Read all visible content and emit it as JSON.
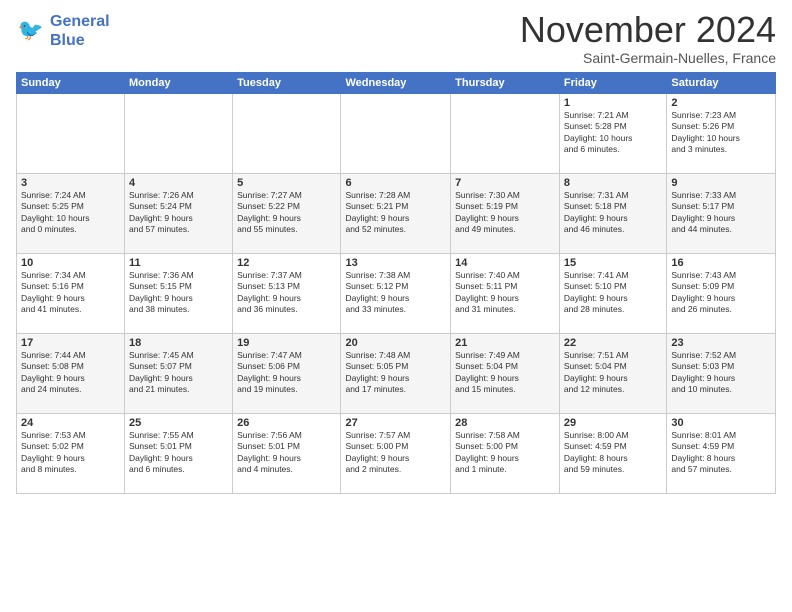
{
  "logo": {
    "line1": "General",
    "line2": "Blue"
  },
  "title": "November 2024",
  "subtitle": "Saint-Germain-Nuelles, France",
  "weekdays": [
    "Sunday",
    "Monday",
    "Tuesday",
    "Wednesday",
    "Thursday",
    "Friday",
    "Saturday"
  ],
  "weeks": [
    [
      {
        "day": "",
        "info": ""
      },
      {
        "day": "",
        "info": ""
      },
      {
        "day": "",
        "info": ""
      },
      {
        "day": "",
        "info": ""
      },
      {
        "day": "",
        "info": ""
      },
      {
        "day": "1",
        "info": "Sunrise: 7:21 AM\nSunset: 5:28 PM\nDaylight: 10 hours\nand 6 minutes."
      },
      {
        "day": "2",
        "info": "Sunrise: 7:23 AM\nSunset: 5:26 PM\nDaylight: 10 hours\nand 3 minutes."
      }
    ],
    [
      {
        "day": "3",
        "info": "Sunrise: 7:24 AM\nSunset: 5:25 PM\nDaylight: 10 hours\nand 0 minutes."
      },
      {
        "day": "4",
        "info": "Sunrise: 7:26 AM\nSunset: 5:24 PM\nDaylight: 9 hours\nand 57 minutes."
      },
      {
        "day": "5",
        "info": "Sunrise: 7:27 AM\nSunset: 5:22 PM\nDaylight: 9 hours\nand 55 minutes."
      },
      {
        "day": "6",
        "info": "Sunrise: 7:28 AM\nSunset: 5:21 PM\nDaylight: 9 hours\nand 52 minutes."
      },
      {
        "day": "7",
        "info": "Sunrise: 7:30 AM\nSunset: 5:19 PM\nDaylight: 9 hours\nand 49 minutes."
      },
      {
        "day": "8",
        "info": "Sunrise: 7:31 AM\nSunset: 5:18 PM\nDaylight: 9 hours\nand 46 minutes."
      },
      {
        "day": "9",
        "info": "Sunrise: 7:33 AM\nSunset: 5:17 PM\nDaylight: 9 hours\nand 44 minutes."
      }
    ],
    [
      {
        "day": "10",
        "info": "Sunrise: 7:34 AM\nSunset: 5:16 PM\nDaylight: 9 hours\nand 41 minutes."
      },
      {
        "day": "11",
        "info": "Sunrise: 7:36 AM\nSunset: 5:15 PM\nDaylight: 9 hours\nand 38 minutes."
      },
      {
        "day": "12",
        "info": "Sunrise: 7:37 AM\nSunset: 5:13 PM\nDaylight: 9 hours\nand 36 minutes."
      },
      {
        "day": "13",
        "info": "Sunrise: 7:38 AM\nSunset: 5:12 PM\nDaylight: 9 hours\nand 33 minutes."
      },
      {
        "day": "14",
        "info": "Sunrise: 7:40 AM\nSunset: 5:11 PM\nDaylight: 9 hours\nand 31 minutes."
      },
      {
        "day": "15",
        "info": "Sunrise: 7:41 AM\nSunset: 5:10 PM\nDaylight: 9 hours\nand 28 minutes."
      },
      {
        "day": "16",
        "info": "Sunrise: 7:43 AM\nSunset: 5:09 PM\nDaylight: 9 hours\nand 26 minutes."
      }
    ],
    [
      {
        "day": "17",
        "info": "Sunrise: 7:44 AM\nSunset: 5:08 PM\nDaylight: 9 hours\nand 24 minutes."
      },
      {
        "day": "18",
        "info": "Sunrise: 7:45 AM\nSunset: 5:07 PM\nDaylight: 9 hours\nand 21 minutes."
      },
      {
        "day": "19",
        "info": "Sunrise: 7:47 AM\nSunset: 5:06 PM\nDaylight: 9 hours\nand 19 minutes."
      },
      {
        "day": "20",
        "info": "Sunrise: 7:48 AM\nSunset: 5:05 PM\nDaylight: 9 hours\nand 17 minutes."
      },
      {
        "day": "21",
        "info": "Sunrise: 7:49 AM\nSunset: 5:04 PM\nDaylight: 9 hours\nand 15 minutes."
      },
      {
        "day": "22",
        "info": "Sunrise: 7:51 AM\nSunset: 5:04 PM\nDaylight: 9 hours\nand 12 minutes."
      },
      {
        "day": "23",
        "info": "Sunrise: 7:52 AM\nSunset: 5:03 PM\nDaylight: 9 hours\nand 10 minutes."
      }
    ],
    [
      {
        "day": "24",
        "info": "Sunrise: 7:53 AM\nSunset: 5:02 PM\nDaylight: 9 hours\nand 8 minutes."
      },
      {
        "day": "25",
        "info": "Sunrise: 7:55 AM\nSunset: 5:01 PM\nDaylight: 9 hours\nand 6 minutes."
      },
      {
        "day": "26",
        "info": "Sunrise: 7:56 AM\nSunset: 5:01 PM\nDaylight: 9 hours\nand 4 minutes."
      },
      {
        "day": "27",
        "info": "Sunrise: 7:57 AM\nSunset: 5:00 PM\nDaylight: 9 hours\nand 2 minutes."
      },
      {
        "day": "28",
        "info": "Sunrise: 7:58 AM\nSunset: 5:00 PM\nDaylight: 9 hours\nand 1 minute."
      },
      {
        "day": "29",
        "info": "Sunrise: 8:00 AM\nSunset: 4:59 PM\nDaylight: 8 hours\nand 59 minutes."
      },
      {
        "day": "30",
        "info": "Sunrise: 8:01 AM\nSunset: 4:59 PM\nDaylight: 8 hours\nand 57 minutes."
      }
    ]
  ]
}
